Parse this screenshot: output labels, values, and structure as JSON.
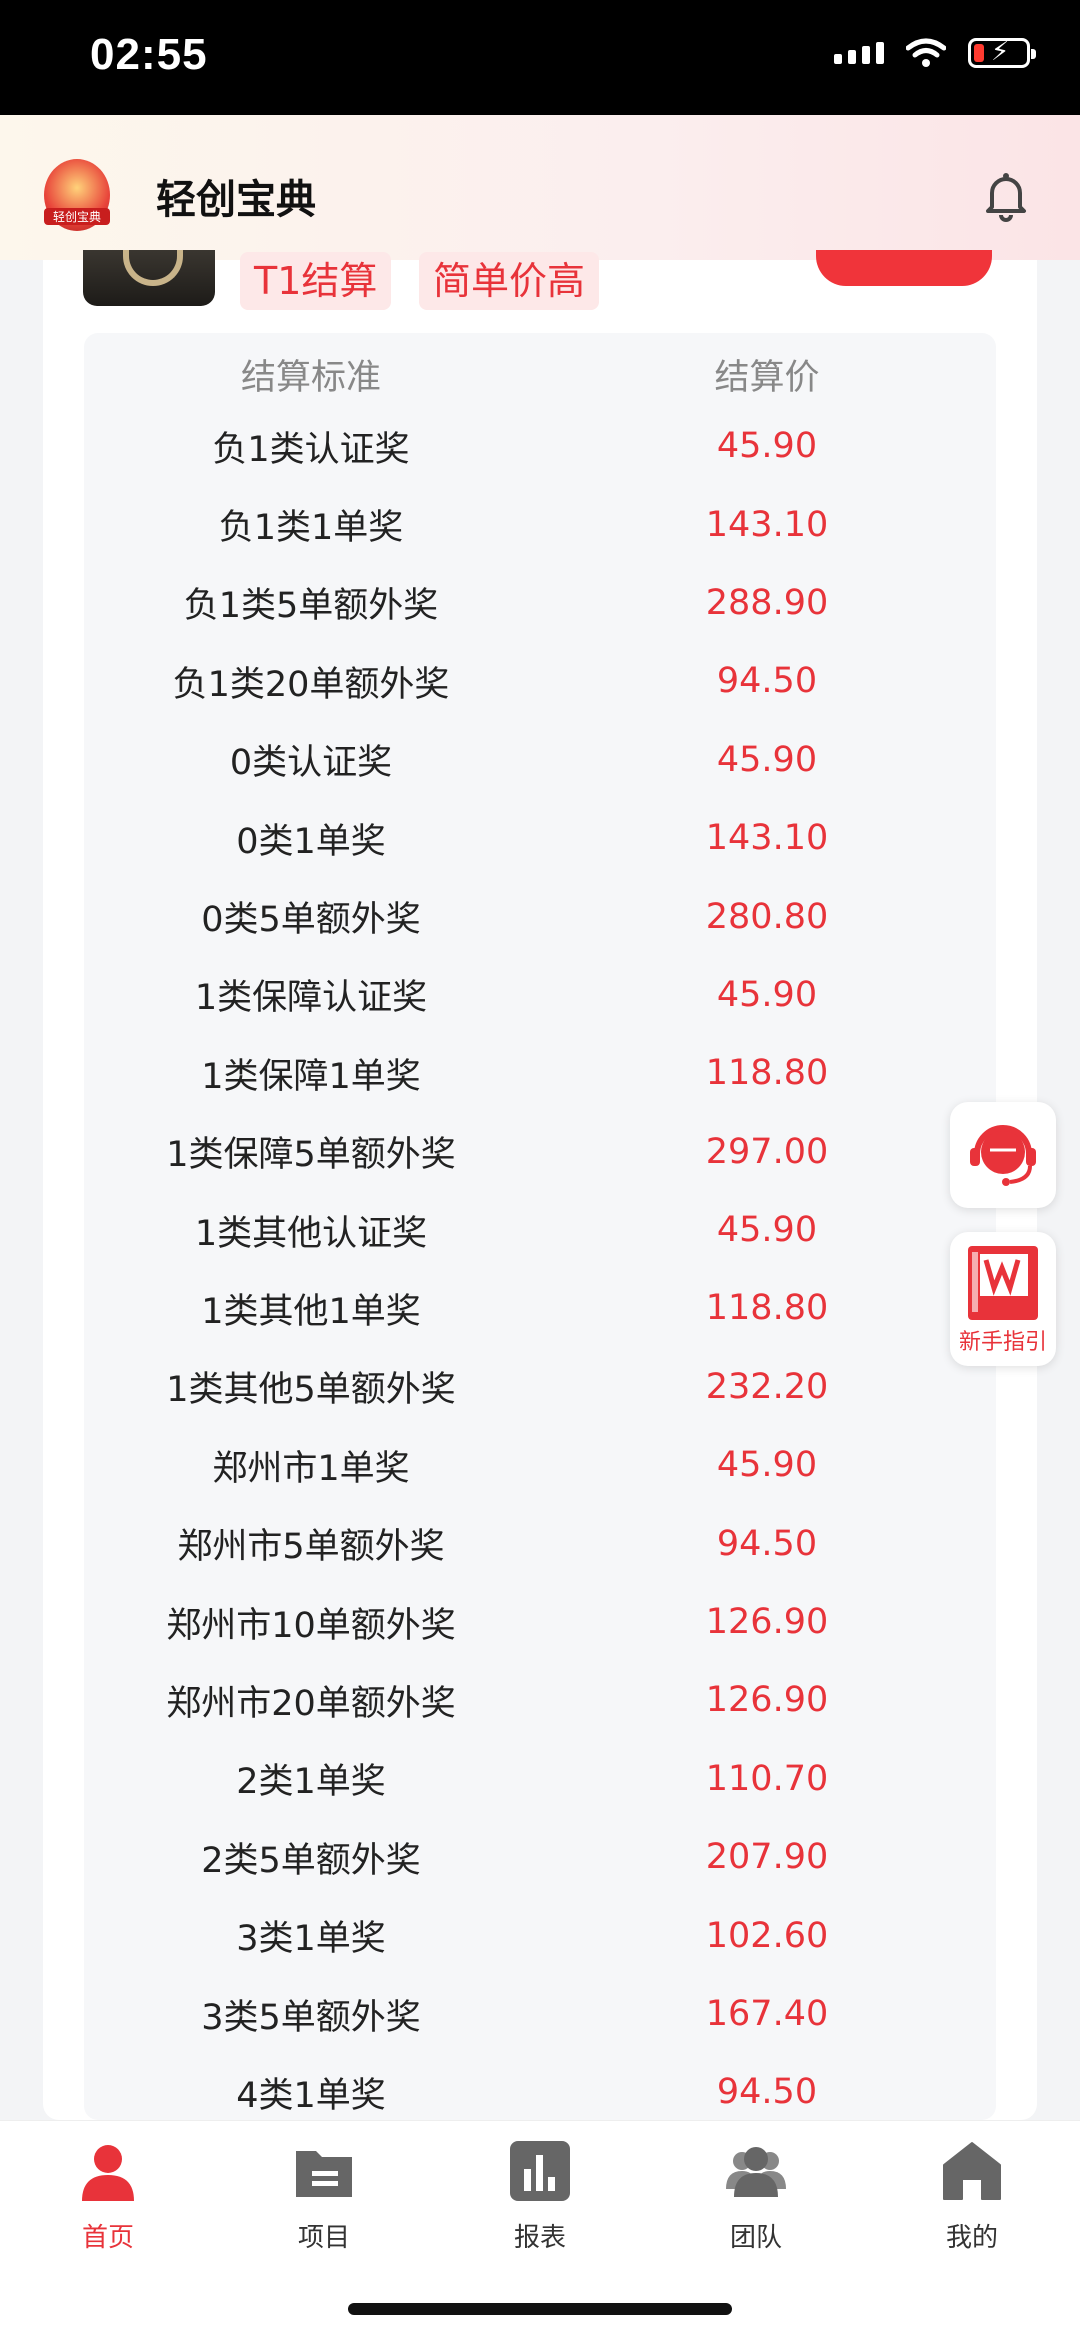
{
  "status_bar": {
    "time": "02:55"
  },
  "header": {
    "app_title": "轻创宝典",
    "logo_text": "轻创宝典"
  },
  "product": {
    "tags": [
      "T1结算",
      "简单价高"
    ]
  },
  "table": {
    "col_standard": "结算标准",
    "col_price": "结算价",
    "rows": [
      {
        "standard": "负1类认证奖",
        "price": "45.90"
      },
      {
        "standard": "负1类1单奖",
        "price": "143.10"
      },
      {
        "standard": "负1类5单额外奖",
        "price": "288.90"
      },
      {
        "standard": "负1类20单额外奖",
        "price": "94.50"
      },
      {
        "standard": "0类认证奖",
        "price": "45.90"
      },
      {
        "standard": "0类1单奖",
        "price": "143.10"
      },
      {
        "standard": "0类5单额外奖",
        "price": "280.80"
      },
      {
        "standard": "1类保障认证奖",
        "price": "45.90"
      },
      {
        "standard": "1类保障1单奖",
        "price": "118.80"
      },
      {
        "standard": "1类保障5单额外奖",
        "price": "297.00"
      },
      {
        "standard": "1类其他认证奖",
        "price": "45.90"
      },
      {
        "standard": "1类其他1单奖",
        "price": "118.80"
      },
      {
        "standard": "1类其他5单额外奖",
        "price": "232.20"
      },
      {
        "standard": "郑州市1单奖",
        "price": "45.90"
      },
      {
        "standard": "郑州市5单额外奖",
        "price": "94.50"
      },
      {
        "standard": "郑州市10单额外奖",
        "price": "126.90"
      },
      {
        "standard": "郑州市20单额外奖",
        "price": "126.90"
      },
      {
        "standard": "2类1单奖",
        "price": "110.70"
      },
      {
        "standard": "2类5单额外奖",
        "price": "207.90"
      },
      {
        "standard": "3类1单奖",
        "price": "102.60"
      },
      {
        "standard": "3类5单额外奖",
        "price": "167.40"
      },
      {
        "standard": "4类1单奖",
        "price": "94.50"
      }
    ]
  },
  "floating": {
    "guide_label": "新手指引"
  },
  "nav": {
    "items": [
      {
        "label": "首页",
        "icon": "person-icon",
        "active": true
      },
      {
        "label": "项目",
        "icon": "folder-icon",
        "active": false
      },
      {
        "label": "报表",
        "icon": "chart-icon",
        "active": false
      },
      {
        "label": "团队",
        "icon": "team-icon",
        "active": false
      },
      {
        "label": "我的",
        "icon": "home-icon",
        "active": false
      }
    ]
  },
  "colors": {
    "accent": "#e8333a",
    "nav_gray": "#666666"
  }
}
